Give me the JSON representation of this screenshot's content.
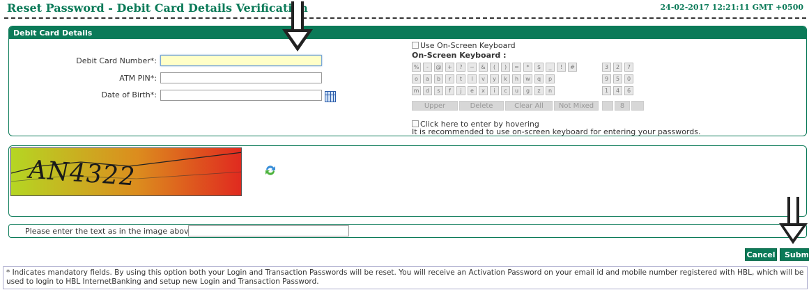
{
  "header": {
    "title": "Reset Password - Debit Card Details Verification",
    "datetime": "24-02-2017 12:21:11 GMT +0500"
  },
  "debit_panel": {
    "heading": "Debit Card Details",
    "card_number_label": "Debit Card Number*:",
    "card_number_value": "",
    "atm_pin_label": "ATM PIN*:",
    "atm_pin_value": "",
    "dob_label": "Date of Birth*:",
    "dob_value": ""
  },
  "keyboard": {
    "use_osk_label": "Use On-Screen Keyboard",
    "osk_heading": "On-Screen Keyboard :",
    "rows": [
      [
        "%",
        "-",
        "@",
        "+",
        "?",
        "~",
        "&",
        "(",
        ")",
        "=",
        "*",
        "$",
        "_",
        "!",
        "#"
      ],
      [
        "o",
        "a",
        "b",
        "r",
        "t",
        "l",
        "v",
        "y",
        "k",
        "h",
        "w",
        "q",
        "p"
      ],
      [
        "m",
        "d",
        "s",
        "f",
        "j",
        "e",
        "x",
        "i",
        "c",
        "u",
        "g",
        "z",
        "n"
      ]
    ],
    "numpad": [
      [
        "3",
        "2",
        "7"
      ],
      [
        "9",
        "5",
        "0"
      ],
      [
        "1",
        "4",
        "6"
      ]
    ],
    "numpad_extra": "8",
    "upper_label": "Upper",
    "delete_label": "Delete",
    "clear_all_label": "Clear All",
    "not_mixed_label": "Not Mixed",
    "hover_label": "Click here to enter by hovering",
    "recommend_text": "It is recommended to use on-screen keyboard for entering your passwords."
  },
  "captcha": {
    "image_text": "AN4322",
    "prompt_label": "Please enter the text as in the image above*:",
    "input_value": ""
  },
  "buttons": {
    "cancel": "Cancel",
    "submit": "Submit"
  },
  "footer_note": "* Indicates mandatory fields. By using this option both your Login and Transaction Passwords will be reset. You will receive an Activation Password on your email id and mobile number registered with HBL, which will be used to login to HBL InternetBanking and setup new Login and Transaction Password.",
  "colors": {
    "brand_green": "#0b7a58",
    "highlight_input": "#ffffc8"
  },
  "icons": [
    "calendar-icon",
    "refresh-icon",
    "down-arrow-annotation"
  ]
}
